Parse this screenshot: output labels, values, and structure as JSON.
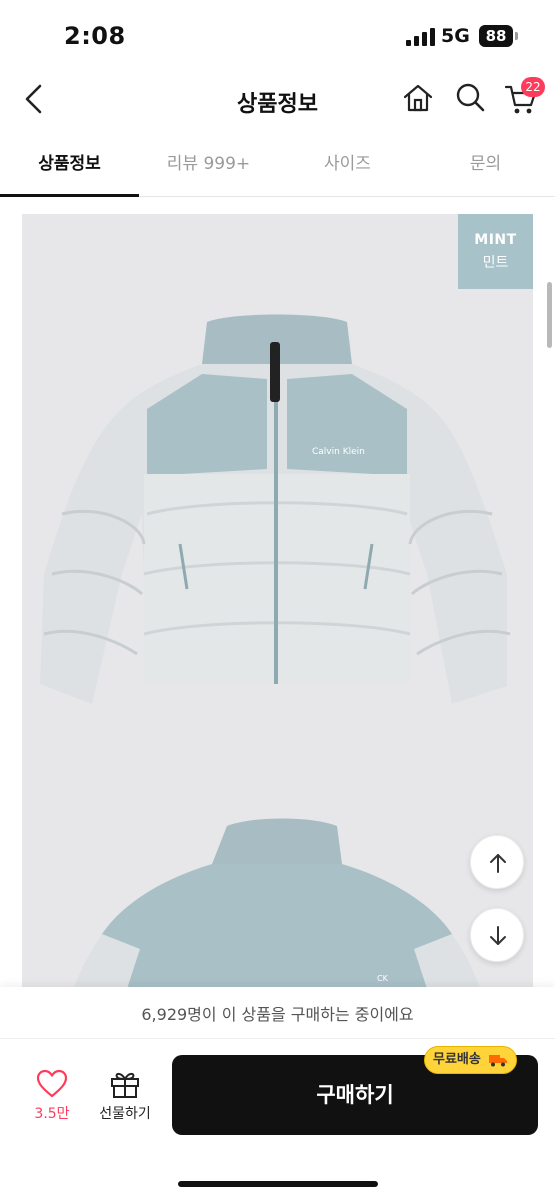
{
  "status_bar": {
    "time": "2:08",
    "network": "5G",
    "battery": "88"
  },
  "header": {
    "title": "상품정보",
    "cart_count": "22",
    "icons": [
      "chevron-left-icon",
      "home-icon",
      "search-icon",
      "cart-icon"
    ]
  },
  "tabs": [
    {
      "label": "상품정보",
      "active": true
    },
    {
      "label": "리뷰 999+",
      "active": false
    },
    {
      "label": "사이즈",
      "active": false
    },
    {
      "label": "문의",
      "active": false
    }
  ],
  "product": {
    "color_chip_en": "MINT",
    "color_chip_ko": "민트",
    "jacket_color": "#a7c2c8"
  },
  "bottom": {
    "notice": "6,929명이 이 상품을 구매하는 중이에요",
    "like_count": "3.5만",
    "gift_label": "선물하기",
    "buy_label": "구매하기",
    "free_shipping_label": "무료배송"
  },
  "colors": {
    "accent": "#ff3b5c",
    "badge": "#ffd43b",
    "buy_button": "#111111"
  }
}
